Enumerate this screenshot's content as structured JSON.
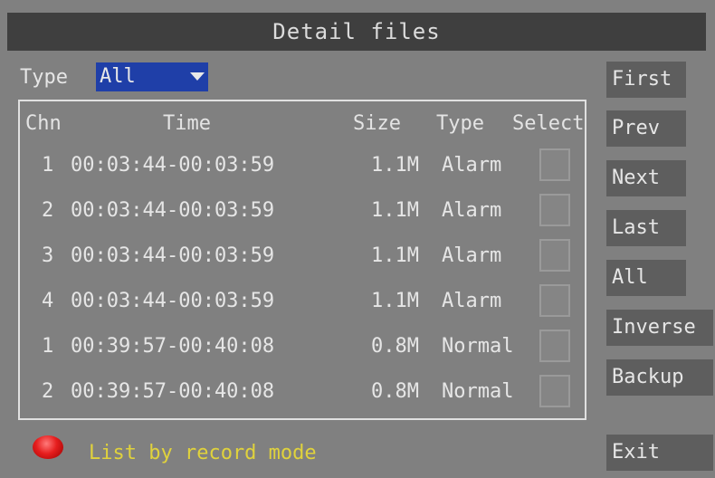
{
  "title": "Detail files",
  "filter": {
    "label": "Type",
    "value": "All"
  },
  "table": {
    "headers": {
      "chn": "Chn",
      "time": "Time",
      "size": "Size",
      "type": "Type",
      "select": "Select"
    },
    "rows": [
      {
        "chn": "1",
        "time": "00:03:44-00:03:59",
        "size": "1.1M",
        "type": "Alarm",
        "selected": false
      },
      {
        "chn": "2",
        "time": "00:03:44-00:03:59",
        "size": "1.1M",
        "type": "Alarm",
        "selected": false
      },
      {
        "chn": "3",
        "time": "00:03:44-00:03:59",
        "size": "1.1M",
        "type": "Alarm",
        "selected": false
      },
      {
        "chn": "4",
        "time": "00:03:44-00:03:59",
        "size": "1.1M",
        "type": "Alarm",
        "selected": false
      },
      {
        "chn": "1",
        "time": "00:39:57-00:40:08",
        "size": "0.8M",
        "type": "Normal",
        "selected": false
      },
      {
        "chn": "2",
        "time": "00:39:57-00:40:08",
        "size": "0.8M",
        "type": "Normal",
        "selected": false
      }
    ]
  },
  "buttons": {
    "first": "First",
    "prev": "Prev",
    "next": "Next",
    "last": "Last",
    "all": "All",
    "inverse": "Inverse",
    "backup": "Backup",
    "exit": "Exit"
  },
  "footer": {
    "text": "List by record mode",
    "indicator_color": "#e61e1e"
  },
  "colors": {
    "title_bg": "#3f3f3f",
    "select_bg": "#1f3fa8",
    "footer_text": "#e0d23c"
  }
}
